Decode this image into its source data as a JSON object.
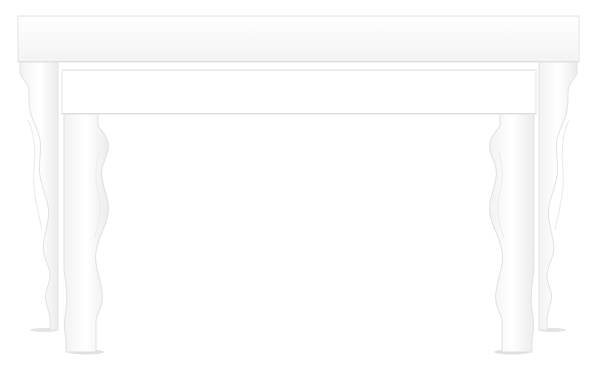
{
  "scene": {
    "subject": "white-nesting-console-tables",
    "background_color": "#ffffff",
    "table_color": "#fbfbfb",
    "edge_color": "#e6e6e6",
    "shadow_color": "#dcdcdc"
  }
}
